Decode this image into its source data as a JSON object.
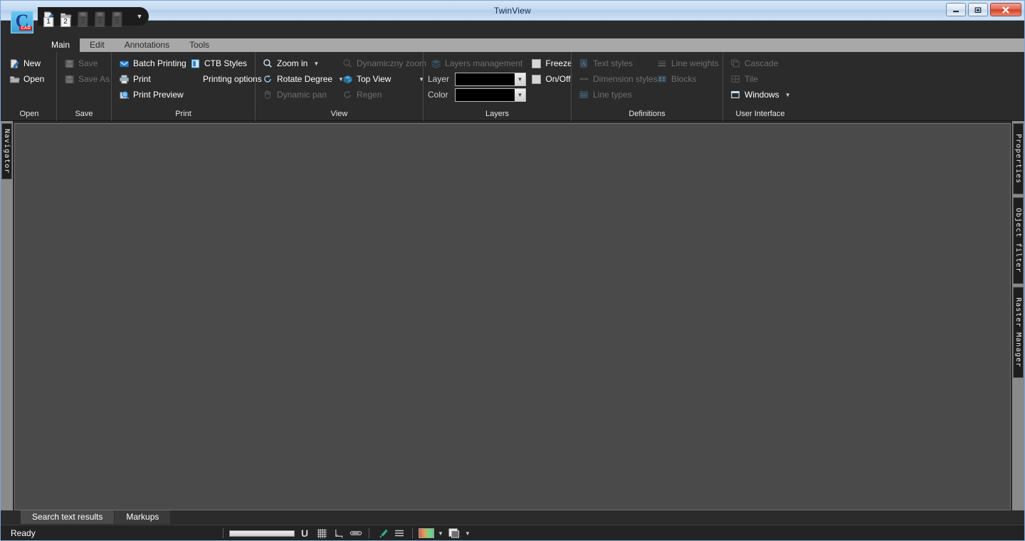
{
  "window": {
    "title": "TwinView",
    "minimize_label": "Minimize",
    "restore_label": "Restore",
    "close_label": "Close"
  },
  "app_logo": {
    "letter": "C",
    "badge": "CAD"
  },
  "quick_access": {
    "items": [
      {
        "name": "new-icon",
        "keytip": "1",
        "enabled": true
      },
      {
        "name": "open-icon",
        "keytip": "2",
        "enabled": true
      },
      {
        "name": "save-icon",
        "keytip": "3",
        "enabled": false
      },
      {
        "name": "save-as-icon",
        "keytip": "4",
        "enabled": false
      },
      {
        "name": "print-icon",
        "keytip": "5",
        "enabled": false
      }
    ],
    "more_label": "▼"
  },
  "ribbon_tabs": [
    {
      "label": "Main",
      "active": true
    },
    {
      "label": "Edit",
      "active": false
    },
    {
      "label": "Annotations",
      "active": false
    },
    {
      "label": "Tools",
      "active": false
    }
  ],
  "ribbon": {
    "open_group": {
      "title": "Open",
      "new_label": "New",
      "open_label": "Open"
    },
    "save_group": {
      "title": "Save",
      "save_label": "Save",
      "save_as_label": "Save As"
    },
    "print_group": {
      "title": "Print",
      "batch_printing_label": "Batch Printing",
      "ctb_styles_label": "CTB Styles",
      "print_label": "Print",
      "printing_options_label": "Printing options",
      "print_preview_label": "Print Preview"
    },
    "view_group": {
      "title": "View",
      "zoom_in_label": "Zoom in",
      "dynamic_zoom_label": "Dynamiczny zoom",
      "rotate_degree_label": "Rotate Degree",
      "top_view_label": "Top View",
      "dynamic_pan_label": "Dynamic pan",
      "regen_label": "Regen"
    },
    "layers_group": {
      "title": "Layers",
      "layers_management_label": "Layers management",
      "layer_label": "Layer",
      "layer_value": "",
      "color_label": "Color",
      "color_value": "",
      "freeze_label": "Freeze",
      "onoff_label": "On/Off"
    },
    "definitions_group": {
      "title": "Definitions",
      "text_styles_label": "Text styles",
      "line_weights_label": "Line weights",
      "dimension_styles_label": "Dimension styles",
      "blocks_label": "Blocks",
      "line_types_label": "Line types"
    },
    "ui_group": {
      "title": "User Interface",
      "cascade_label": "Cascade",
      "tile_label": "Tile",
      "windows_label": "Windows"
    }
  },
  "left_dock": {
    "tabs": [
      {
        "label": "Navigator",
        "name": "navigator"
      }
    ]
  },
  "right_dock": {
    "tabs": [
      {
        "label": "Properties",
        "name": "properties"
      },
      {
        "label": "Object filter",
        "name": "object-filter"
      },
      {
        "label": "Raster Manager",
        "name": "raster-manager"
      }
    ]
  },
  "bottom_tabs": [
    {
      "label": "Search text results",
      "active": true
    },
    {
      "label": "Markups",
      "active": false
    }
  ],
  "status_bar": {
    "message": "Ready",
    "tools": [
      {
        "name": "zoom-slider",
        "glyph": ""
      },
      {
        "name": "snap-magnet-icon",
        "glyph": "U"
      },
      {
        "name": "grid-icon",
        "glyph": "▦"
      },
      {
        "name": "ortho-angle-icon",
        "glyph": "⊾"
      },
      {
        "name": "capsule-icon",
        "glyph": "▭"
      },
      {
        "name": "pen-icon",
        "glyph": "✎"
      },
      {
        "name": "lines-icon",
        "glyph": "☰"
      },
      {
        "name": "color-swatch",
        "glyph": ""
      },
      {
        "name": "layer-swatch",
        "glyph": ""
      }
    ]
  },
  "colors": {
    "accent": "#3a9fd8",
    "ribbon_bg": "#2b2b2b",
    "canvas": "#4a4a4a",
    "title_bar": "#c3d9f0",
    "close_button": "#cf4027",
    "disabled_text": "#6f6f6f"
  }
}
